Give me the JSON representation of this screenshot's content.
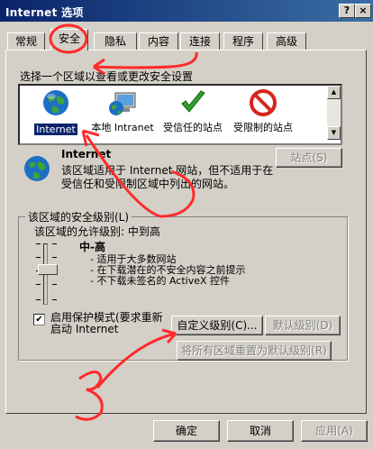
{
  "window": {
    "title": "Internet 选项",
    "help_label": "?",
    "close_label": "×"
  },
  "tabs": [
    "常规",
    "安全",
    "隐私",
    "内容",
    "连接",
    "程序",
    "高级"
  ],
  "zone_prompt": "选择一个区域以查看或更改安全设置",
  "zones": [
    {
      "label": "Internet"
    },
    {
      "label": "本地 Intranet"
    },
    {
      "label": "受信任的站点"
    },
    {
      "label": "受限制的站点"
    }
  ],
  "zone_detail": {
    "title": "Internet",
    "description": "该区域适用于 Internet 网站，但不适用于在受信任和受限制区域中列出的网站。",
    "sites_button": "站点(S)"
  },
  "security_level": {
    "group_label": "该区域的安全级别(L)",
    "allowed_text": "该区域的允许级别: 中到高",
    "level_name": "中-高",
    "bullets": [
      "- 适用于大多数网站",
      "- 在下载潜在的不安全内容之前提示",
      "- 不下载未签名的 ActiveX 控件"
    ]
  },
  "protected_mode": {
    "label": "启用保护模式(要求重新启动 Internet",
    "checked": true,
    "check_mark": "✔"
  },
  "buttons": {
    "custom_level": "自定义级别(C)...",
    "default_level": "默认级别(D)",
    "reset_all": "将所有区域重置为默认级别(R)",
    "ok": "确定",
    "cancel": "取消",
    "apply": "应用(A)"
  },
  "colors": {
    "dialog_bg": "#d4d0c8",
    "title_start": "#0a246a",
    "title_end": "#3a6ea5",
    "annotation": "#ff2a2a"
  },
  "icons": {
    "internet": "globe-icon",
    "intranet": "computer-globe-icon",
    "trusted": "checkmark-icon",
    "restricted": "no-entry-icon"
  }
}
